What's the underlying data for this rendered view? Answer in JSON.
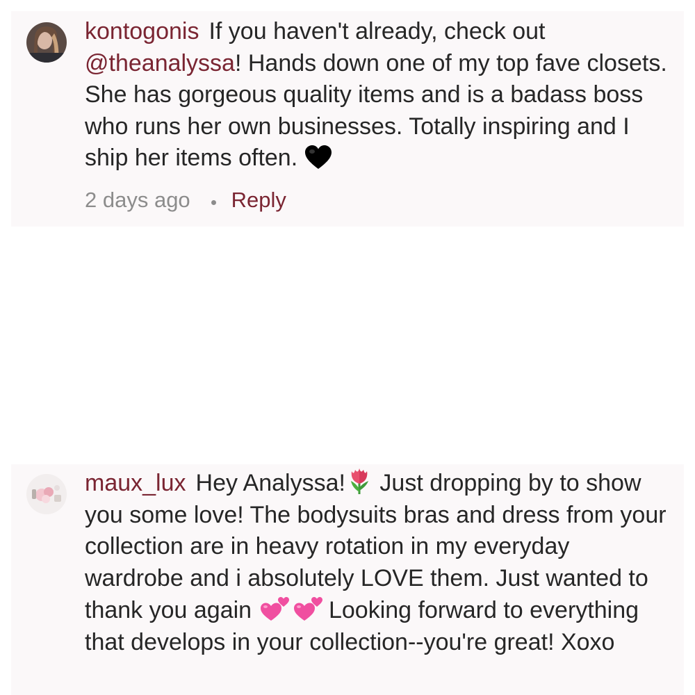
{
  "comments": [
    {
      "username": "kontogonis",
      "text_before": "If you haven't already, check out ",
      "mention": "@theanalyssa",
      "text_after": "! Hands down one of my top fave closets. She has gorgeous quality items and is a badass boss who runs her own businesses. Totally inspiring and I ship her items often.",
      "emoji": "black-heart-icon",
      "timestamp": "2 days ago",
      "reply_label": "Reply"
    },
    {
      "username": "maux_lux",
      "text_part1": "Hey Analyssa!",
      "emoji1": "tulip-icon",
      "text_part2": " Just dropping by to show you some love! The bodysuits bras and dress from your collection are in heavy rotation in my everyday wardrobe and i absolutely LOVE them. Just wanted to thank you again ",
      "emoji2": "two-hearts-icon",
      "text_part3": " Looking forward to everything that develops in your collection--you're great! Xoxo"
    }
  ],
  "colors": {
    "card_background": "#fbf8f9",
    "username": "#7a2532",
    "meta_text": "#8c8c8c",
    "body_text": "#262626"
  }
}
